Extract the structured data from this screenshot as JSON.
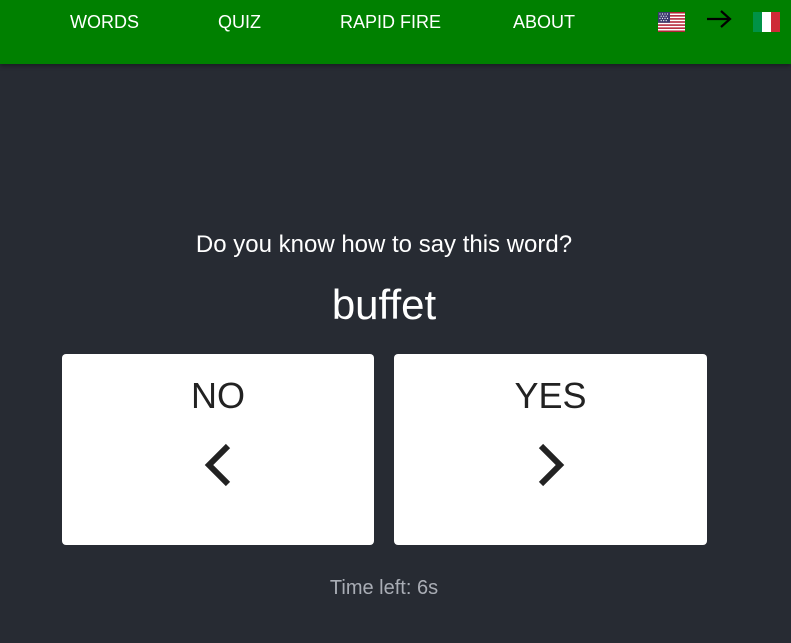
{
  "nav": {
    "links": [
      "WORDS",
      "QUIZ",
      "RAPID FIRE",
      "ABOUT"
    ],
    "source_language_flag": "us-flag-icon",
    "direction_icon": "arrow-right-icon",
    "target_language_flag": "italy-flag-icon",
    "background_color": "#008000"
  },
  "game": {
    "prompt": "Do you know how to say this word?",
    "word": "buffet",
    "no_label": "NO",
    "yes_label": "YES",
    "no_icon": "chevron-left-icon",
    "yes_icon": "chevron-right-icon",
    "timer_text": "Time left: 6s"
  },
  "colors": {
    "page_background": "#272b33",
    "card_background": "#ffffff",
    "timer_text": "#a9adb5"
  }
}
